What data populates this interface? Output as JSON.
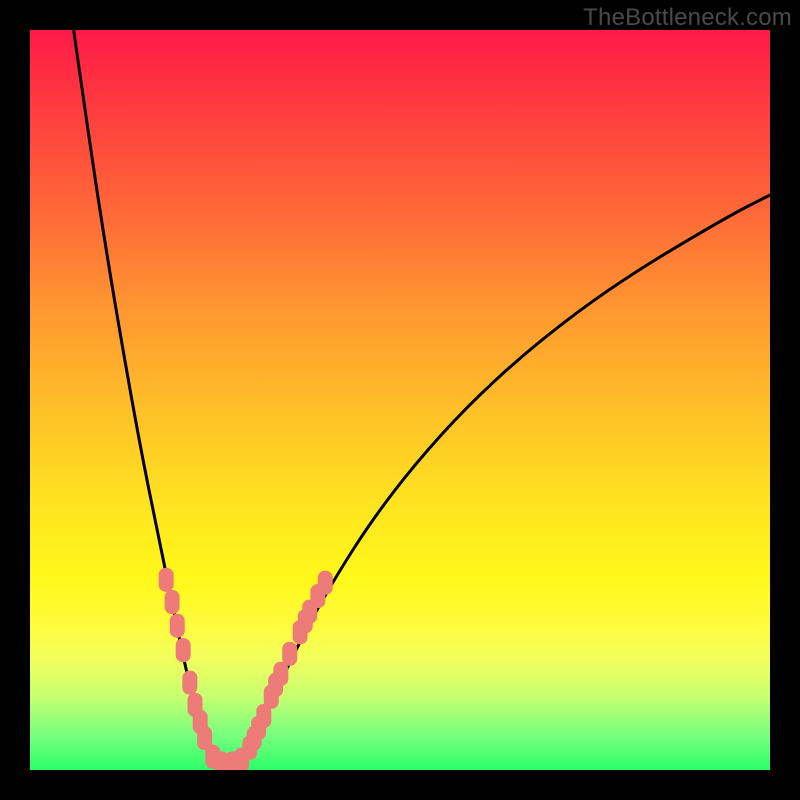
{
  "watermark": "TheBottleneck.com",
  "colors": {
    "frame": "#000000",
    "marker": "#ed7b78",
    "curve": "#000000",
    "watermark_text": "#4a4a4a"
  },
  "chart_data": {
    "type": "line",
    "title": "",
    "xlabel": "",
    "ylabel": "",
    "xlim": [
      0,
      100
    ],
    "ylim": [
      0,
      100
    ],
    "notes": "Unlabeled V-shaped bottleneck curve on rainbow heat background. No axes or ticks are rendered. x/y values are in percent of plot area; y=0 is bottom (green), y=100 is top (red). Curve reads visually as bottleneck-percentage vs some hardware parameter.",
    "series": [
      {
        "name": "left-branch",
        "x": [
          5.9,
          8.2,
          10.5,
          12.8,
          15.0,
          17.1,
          18.9,
          20.3,
          21.5,
          22.6,
          23.5,
          24.4
        ],
        "y": [
          100.0,
          83.8,
          68.9,
          55.4,
          43.2,
          32.8,
          24.1,
          17.2,
          11.8,
          7.6,
          4.3,
          2.0
        ]
      },
      {
        "name": "valley",
        "x": [
          24.4,
          25.7,
          27.0,
          28.4,
          29.3
        ],
        "y": [
          2.0,
          0.8,
          0.8,
          1.2,
          2.0
        ]
      },
      {
        "name": "right-branch",
        "x": [
          29.3,
          30.8,
          32.6,
          34.9,
          37.8,
          41.5,
          46.1,
          51.9,
          59.2,
          68.3,
          79.7,
          94.1,
          100.0
        ],
        "y": [
          2.0,
          5.0,
          9.1,
          14.1,
          19.9,
          26.4,
          33.6,
          41.2,
          49.3,
          57.6,
          66.1,
          74.7,
          77.7
        ]
      }
    ],
    "markers": {
      "name": "highlighted-points",
      "comment": "Salmon rounded-rect markers clustered along the lower part of the V.",
      "points": [
        {
          "x": 18.4,
          "y": 25.7
        },
        {
          "x": 19.2,
          "y": 22.7
        },
        {
          "x": 19.9,
          "y": 19.5
        },
        {
          "x": 20.7,
          "y": 16.2
        },
        {
          "x": 21.6,
          "y": 11.8
        },
        {
          "x": 22.3,
          "y": 8.8
        },
        {
          "x": 23.0,
          "y": 6.5
        },
        {
          "x": 23.6,
          "y": 4.3
        },
        {
          "x": 24.7,
          "y": 1.8
        },
        {
          "x": 25.9,
          "y": 0.9
        },
        {
          "x": 27.4,
          "y": 0.9
        },
        {
          "x": 28.6,
          "y": 1.4
        },
        {
          "x": 29.7,
          "y": 3.0
        },
        {
          "x": 30.3,
          "y": 4.3
        },
        {
          "x": 30.9,
          "y": 5.7
        },
        {
          "x": 31.6,
          "y": 7.3
        },
        {
          "x": 32.6,
          "y": 9.9
        },
        {
          "x": 33.2,
          "y": 11.5
        },
        {
          "x": 33.9,
          "y": 13.0
        },
        {
          "x": 35.1,
          "y": 15.7
        },
        {
          "x": 36.5,
          "y": 18.6
        },
        {
          "x": 37.2,
          "y": 20.1
        },
        {
          "x": 37.8,
          "y": 21.4
        },
        {
          "x": 38.9,
          "y": 23.5
        },
        {
          "x": 39.9,
          "y": 25.3
        }
      ]
    }
  }
}
